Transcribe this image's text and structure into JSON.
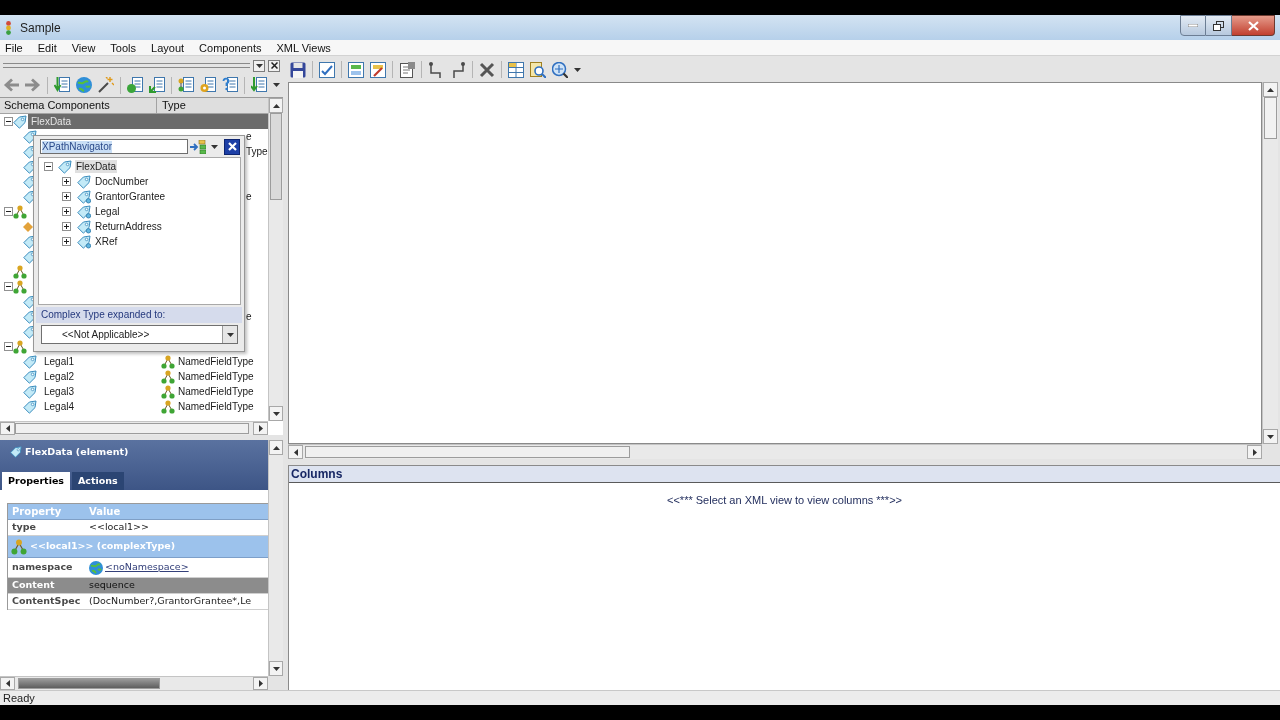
{
  "window": {
    "title": "Sample"
  },
  "menu": [
    "File",
    "Edit",
    "View",
    "Tools",
    "Layout",
    "Components",
    "XML Views"
  ],
  "schema_tree": {
    "columns": [
      "Schema Components",
      "Type"
    ],
    "rows": [
      {
        "kind": "element",
        "name": "FlexData",
        "expanded": true,
        "selected": true,
        "children": [
          {
            "kind": "element",
            "type": "e"
          },
          {
            "kind": "element",
            "type": "Type"
          },
          {
            "kind": "element"
          },
          {
            "kind": "element"
          },
          {
            "kind": "element",
            "type": "e"
          }
        ]
      },
      {
        "kind": "complex",
        "expanded": true,
        "children": [
          {
            "kind": "attribute"
          },
          {
            "kind": "element"
          },
          {
            "kind": "element"
          }
        ]
      },
      {
        "kind": "complex"
      },
      {
        "kind": "complex",
        "expanded": true,
        "children": [
          {
            "kind": "element"
          },
          {
            "kind": "element",
            "type": "e"
          },
          {
            "kind": "element"
          }
        ]
      },
      {
        "kind": "complex",
        "expanded": true,
        "children": [
          {
            "kind": "element",
            "name": "Legal1",
            "type": "NamedFieldType",
            "selected": false
          },
          {
            "kind": "element",
            "name": "Legal2",
            "type": "NamedFieldType",
            "selected": false
          },
          {
            "kind": "element",
            "name": "Legal3",
            "type": "NamedFieldType",
            "selected": false
          },
          {
            "kind": "element",
            "name": "Legal4",
            "type": "NamedFieldType",
            "selected": false
          }
        ]
      }
    ]
  },
  "xpath_navigator": {
    "value": "XPathNavigator",
    "tree": [
      {
        "kind": "simple_element",
        "name": "FlexData",
        "expanded": true,
        "selected": true,
        "children": [
          {
            "kind": "simple_element",
            "name": "DocNumber",
            "expanded": false,
            "selected": false
          },
          {
            "kind": "complex_element",
            "name": "GrantorGrantee",
            "expanded": false,
            "selected": false
          },
          {
            "kind": "complex_element",
            "name": "Legal",
            "expanded": false,
            "selected": false
          },
          {
            "kind": "complex_element",
            "name": "ReturnAddress",
            "expanded": false,
            "selected": false
          },
          {
            "kind": "complex_element",
            "name": "XRef",
            "expanded": false,
            "selected": false
          }
        ]
      }
    ],
    "expanded_to_label": "Complex Type expanded to:",
    "expanded_to_value": "<<Not Applicable>>"
  },
  "details": {
    "title": "FlexData (element)",
    "tabs": [
      {
        "label": "Properties",
        "selected": true
      },
      {
        "label": "Actions",
        "selected": false
      }
    ],
    "columns": [
      "Property",
      "Value"
    ],
    "rows": [
      {
        "kind": "property",
        "name": "type",
        "value": "<<local1>>",
        "selected": false
      },
      {
        "kind": "section",
        "label": "<<local1>> (complexType)",
        "selected": false
      },
      {
        "kind": "link",
        "name": "namespace",
        "value": "<noNamespace>",
        "selected": false
      },
      {
        "kind": "property",
        "name": "Content",
        "value": "sequence",
        "selected": true
      },
      {
        "kind": "property",
        "name": "ContentSpec",
        "value": "(DocNumber?,GrantorGrantee*,Le",
        "selected": false
      }
    ]
  },
  "columns_panel": {
    "title": "Columns",
    "message": "<<*** Select an XML view to view columns ***>>"
  },
  "status_bar": {
    "text": "Ready"
  }
}
